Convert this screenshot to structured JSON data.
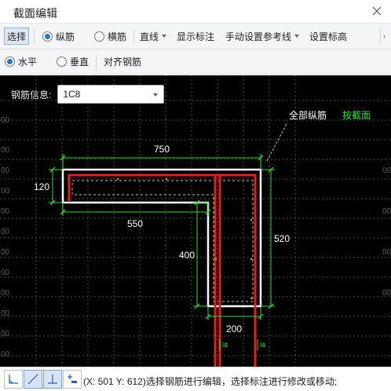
{
  "window": {
    "title": "截面编辑"
  },
  "toolbar1": {
    "select": "选择",
    "longitudinal": "纵筋",
    "transverse": "横筋",
    "line": "直线",
    "show_annotation": "显示标注",
    "manual_ref_line": "手动设置参考线",
    "set_elevation": "设置标高"
  },
  "toolbar2": {
    "horizontal": "水平",
    "vertical": "垂直",
    "align_rebar": "对齐钢筋"
  },
  "rebar_info": {
    "label": "钢筋信息:",
    "value": "1C8"
  },
  "legend": {
    "all_longitudinal": "全部纵筋",
    "by_section": "按截面"
  },
  "grid_labels": [
    "00",
    "00",
    "00",
    "00",
    "00",
    "00",
    "00",
    "00",
    "00",
    "00",
    "00",
    "00",
    "00",
    "00",
    "00",
    "00"
  ],
  "dimensions": {
    "top_width": "750",
    "left_height": "120",
    "inner_width": "550",
    "right_height": "520",
    "inner_height": "400",
    "bottom_width": "200",
    "anchor_label": "la"
  },
  "status": {
    "text": "(X: 501 Y: 612)选择钢筋进行编辑，选择标注进行修改或移动;"
  },
  "colors": {
    "canvas_bg": "#000000",
    "section_outline": "#ffffff",
    "rebar": "#e02020",
    "dimension": "#33dd33",
    "grid": "#555555"
  }
}
